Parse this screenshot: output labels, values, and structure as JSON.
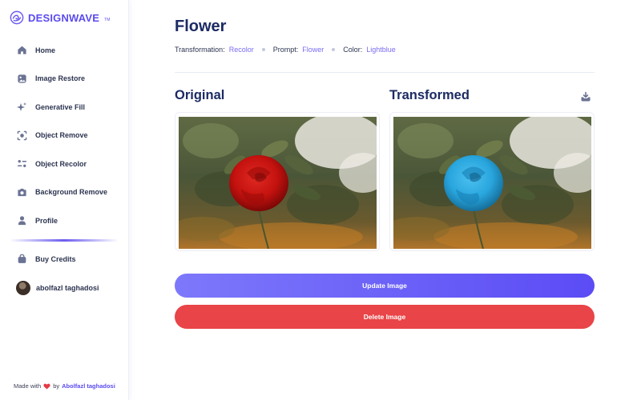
{
  "brand": {
    "name": "DESIGNWAVE",
    "tm": "TM"
  },
  "nav": {
    "items": [
      {
        "label": "Home",
        "icon": "home-icon"
      },
      {
        "label": "Image Restore",
        "icon": "image-restore-icon"
      },
      {
        "label": "Generative Fill",
        "icon": "sparkle-icon"
      },
      {
        "label": "Object Remove",
        "icon": "scan-icon"
      },
      {
        "label": "Object Recolor",
        "icon": "filter-icon"
      },
      {
        "label": "Background Remove",
        "icon": "camera-icon"
      },
      {
        "label": "Profile",
        "icon": "user-icon"
      }
    ],
    "credits": {
      "label": "Buy Credits",
      "icon": "bag-icon"
    }
  },
  "user": {
    "name": "abolfazl taghadosi"
  },
  "footer": {
    "made_with": "Made with",
    "by": "by",
    "author": "Abolfazl taghadosi"
  },
  "page": {
    "title": "Flower",
    "meta": [
      {
        "key": "Transformation:",
        "value": "Recolor"
      },
      {
        "key": "Prompt:",
        "value": "Flower"
      },
      {
        "key": "Color:",
        "value": "Lightblue"
      }
    ],
    "original_label": "Original",
    "transformed_label": "Transformed"
  },
  "actions": {
    "update": "Update Image",
    "delete": "Delete Image"
  },
  "colors": {
    "accent": "#5b4bf0",
    "delete": "#e94447",
    "rose_original": "#c4120f",
    "rose_transformed": "#29a6de"
  }
}
